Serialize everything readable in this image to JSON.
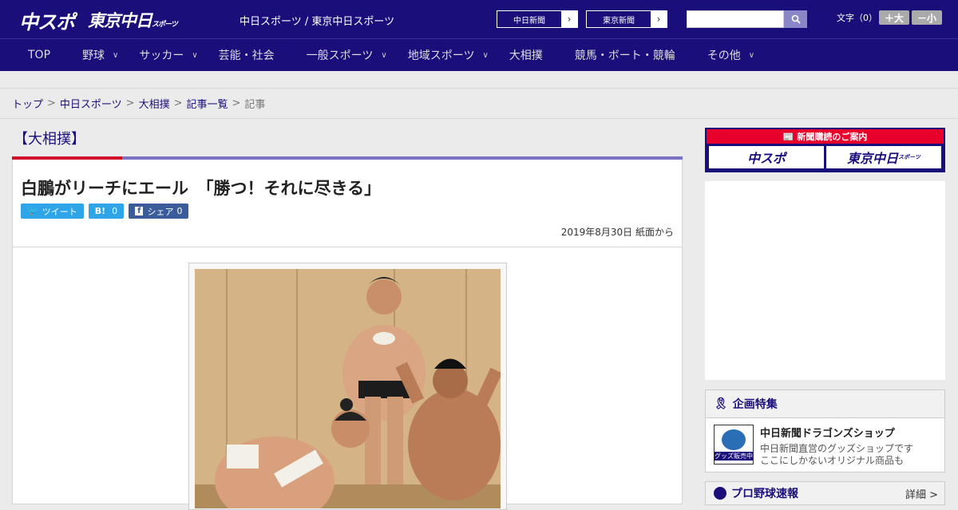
{
  "header": {
    "logo_chuspo": "中スポ",
    "logo_tokyo": "東京中日",
    "logo_tokyo_small": "スポーツ",
    "site_name": "中日スポーツ / 東京中日スポーツ",
    "paper1_label": "中日新聞",
    "paper2_label": "東京新聞",
    "search_placeholder": "",
    "font_size_label": "文字（0）",
    "font_larger": "＋大",
    "font_smaller": "－小"
  },
  "nav": {
    "items": [
      {
        "label": "TOP"
      },
      {
        "label": "野球"
      },
      {
        "label": "サッカー"
      },
      {
        "label": "芸能・社会"
      },
      {
        "label": "一般スポーツ"
      },
      {
        "label": "地域スポーツ"
      },
      {
        "label": "大相撲"
      },
      {
        "label": "競馬・ボート・競輪"
      },
      {
        "label": "その他"
      }
    ]
  },
  "breadcrumb": {
    "items": [
      "トップ",
      "中日スポーツ",
      "大相撲",
      "記事一覧"
    ],
    "current": "記事"
  },
  "article": {
    "category": "【大相撲】",
    "headline": "白鵬がリーチにエール　「勝つ！それに尽きる」",
    "tweet_label": "ツイート",
    "hatena_label": "B!",
    "hatena_count": "0",
    "share_label": "シェア",
    "share_count": "0",
    "dateline": "2019年8月30日 紙面から"
  },
  "sidebar": {
    "subscribe_title": "新聞購読のご案内",
    "subscribe_btn1": "中スポ",
    "subscribe_btn2": "東京中日",
    "subscribe_btn2_small": "スポーツ",
    "feature_title": "企画特集",
    "feature_thumb_label": "グッズ販売中",
    "feature_item_title": "中日新聞ドラゴンズショップ",
    "feature_item_desc1": "中日新聞直営のグッズショップです",
    "feature_item_desc2": "ここにしかないオリジナル商品も",
    "baseball_title": "プロ野球速報",
    "baseball_more": "詳細 >"
  },
  "colors": {
    "brand_navy": "#1a0f7a",
    "accent_red": "#d0102a",
    "twitter_blue": "#2da5e8",
    "facebook_blue": "#3b5c9a"
  }
}
